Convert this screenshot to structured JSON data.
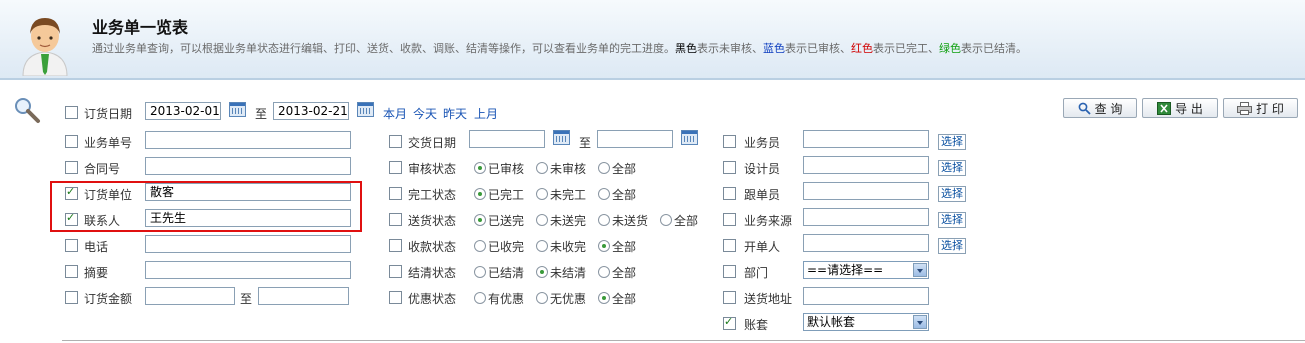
{
  "header": {
    "title": "业务单一览表",
    "desc_main": "通过业务单查询，可以根据业务单状态进行编辑、打印、送货、收款、调账、结清等操作，可以查看业务单的完工进度。",
    "legend_black": "黑色",
    "legend_black_text": "表示未审核、",
    "legend_blue": "蓝色",
    "legend_blue_text": "表示已审核、",
    "legend_red": "红色",
    "legend_red_text": "表示已完工、",
    "legend_green": "绿色",
    "legend_green_text": "表示已结清。"
  },
  "buttons": {
    "query": "查 询",
    "export": "导 出",
    "print": "打 印"
  },
  "row1": {
    "label": "订货日期",
    "from": "2013-02-01",
    "to_text": "至",
    "to": "2013-02-21",
    "quick": [
      "本月",
      "今天",
      "昨天",
      "上月"
    ]
  },
  "col1": {
    "order_no": "业务单号",
    "contract_no": "合同号",
    "customer": "订货单位",
    "customer_value": "散客",
    "contact": "联系人",
    "contact_value": "王先生",
    "phone": "电话",
    "summary": "摘要",
    "amount": "订货金额",
    "amount_to": "至"
  },
  "col2": {
    "delivery_date": "交货日期",
    "delivery_to": "至",
    "audit": {
      "label": "审核状态",
      "options": [
        "已审核",
        "未审核",
        "全部"
      ]
    },
    "complete": {
      "label": "完工状态",
      "options": [
        "已完工",
        "未完工",
        "全部"
      ]
    },
    "ship": {
      "label": "送货状态",
      "options": [
        "已送完",
        "未送完",
        "未送货",
        "全部"
      ]
    },
    "receive": {
      "label": "收款状态",
      "options": [
        "已收完",
        "未收完",
        "全部"
      ]
    },
    "settle": {
      "label": "结清状态",
      "options": [
        "已结清",
        "未结清",
        "全部"
      ]
    },
    "discount": {
      "label": "优惠状态",
      "options": [
        "有优惠",
        "无优惠",
        "全部"
      ]
    }
  },
  "col3": {
    "salesman": "业务员",
    "designer": "设计员",
    "follower": "跟单员",
    "source": "业务来源",
    "creator": "开单人",
    "dept": "部门",
    "dept_value": "==请选择==",
    "address": "送货地址",
    "account": "账套",
    "account_value": "默认帐套",
    "pick": "选择"
  }
}
